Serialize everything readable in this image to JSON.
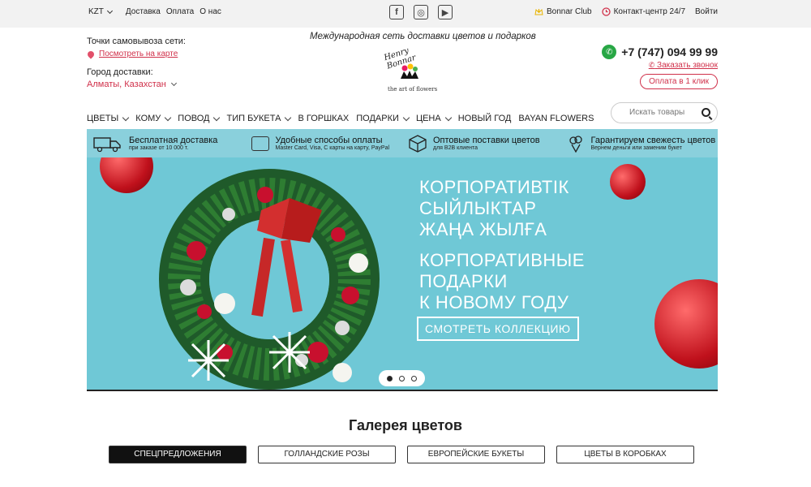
{
  "topbar": {
    "currency": "KZT",
    "links": [
      "Доставка",
      "Оплата",
      "О нас"
    ],
    "social": [
      {
        "icon": "facebook-icon",
        "glyph": "f"
      },
      {
        "icon": "instagram-icon",
        "glyph": "◎"
      },
      {
        "icon": "youtube-icon",
        "glyph": "▶"
      }
    ],
    "club": "Bonnar Club",
    "contact": "Контакт-центр 24/7",
    "login": "Войти"
  },
  "pickup": {
    "label": "Точки самовывоза сети:",
    "map_link": "Посмотреть на карте"
  },
  "city": {
    "label": "Город доставки:",
    "value": "Алматы, Казахстан"
  },
  "header": {
    "tagline": "Международная сеть доставки цветов и подарков",
    "logo_script": "Henry Bonnar",
    "logo_sub": "the art of flowers",
    "phone": "+7 (747) 094 99 99",
    "callback": "Заказать звонок",
    "pay_button": "Оплата в 1 клик"
  },
  "nav": {
    "items": [
      {
        "label": "ЦВЕТЫ",
        "dropdown": true
      },
      {
        "label": "КОМУ",
        "dropdown": true
      },
      {
        "label": "ПОВОД",
        "dropdown": true
      },
      {
        "label": "ТИП БУКЕТА",
        "dropdown": true
      },
      {
        "label": "В ГОРШКАХ",
        "dropdown": false
      },
      {
        "label": "ПОДАРКИ",
        "dropdown": true
      },
      {
        "label": "ЦЕНА",
        "dropdown": true
      },
      {
        "label": "НОВЫЙ ГОД",
        "dropdown": false
      },
      {
        "label": "BAYAN FLOWERS",
        "dropdown": false
      }
    ],
    "search_placeholder": "Искать товары"
  },
  "features": [
    {
      "icon": "truck-icon",
      "title": "Бесплатная доставка",
      "sub": "при заказе от 10 000 т."
    },
    {
      "icon": "card-icon",
      "title": "Удобные способы оплаты",
      "sub": "Master Card, Visa, С карты на карту, PayPal"
    },
    {
      "icon": "box-icon",
      "title": "Оптовые поставки цветов",
      "sub": "для B2B клиента"
    },
    {
      "icon": "bouquet-icon",
      "title": "Гарантируем свежесть цветов",
      "sub": "Вернем деньги или заменим букет"
    }
  ],
  "banner": {
    "lines_kz": [
      "КОРПОРАТИВТІК",
      "СЫЙЛЫКТАР",
      "ЖАҢА ЖЫЛҒА"
    ],
    "lines_ru": [
      "КОРПОРАТИВНЫЕ",
      "ПОДАРКИ",
      "К НОВОМУ ГОДУ"
    ],
    "cta": "СМОТРЕТЬ КОЛЛЕКЦИЮ",
    "slides": 3,
    "active_slide": 1
  },
  "gallery": {
    "title": "Галерея цветов",
    "tabs": [
      "СПЕЦПРЕДЛОЖЕНИЯ",
      "ГОЛЛАНДСКИЕ РОЗЫ",
      "ЕВРОПЕЙСКИЕ БУКЕТЫ",
      "ЦВЕТЫ В КОРОБКАХ"
    ],
    "active_tab": 0
  },
  "colors": {
    "accent": "#d0304a",
    "banner_bg": "#6fc8d6",
    "strip_bg": "#8ad0dc"
  }
}
